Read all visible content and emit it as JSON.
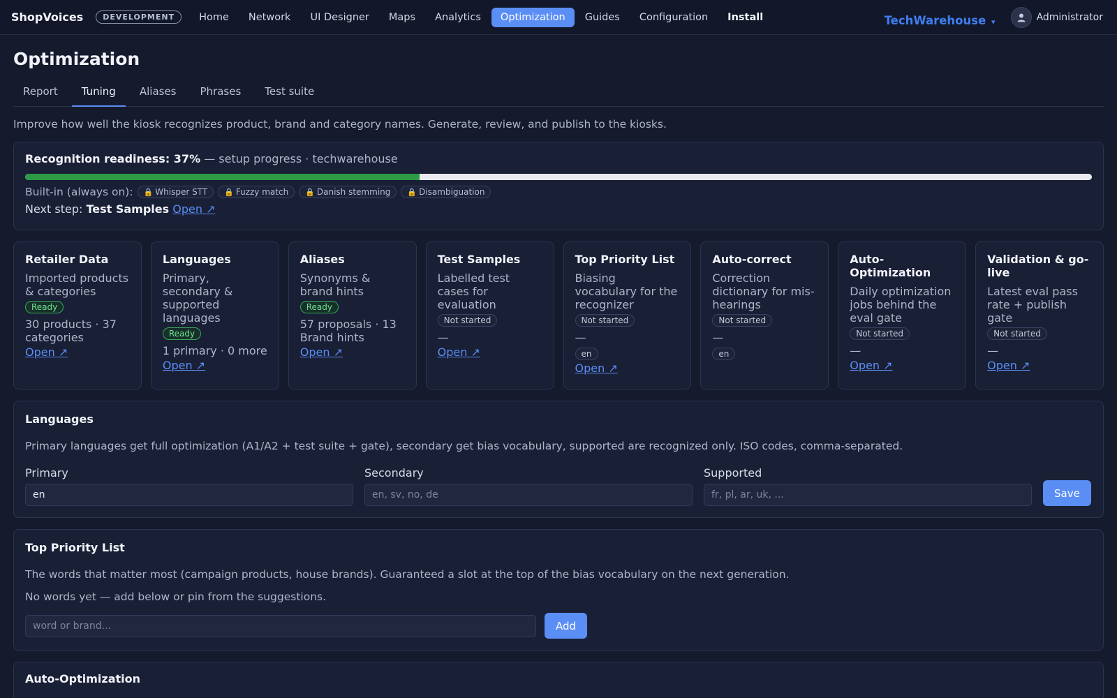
{
  "header": {
    "brand": "ShopVoices",
    "env_badge": "DEVELOPMENT",
    "nav": [
      "Home",
      "Network",
      "UI Designer",
      "Maps",
      "Analytics",
      "Optimization",
      "Guides",
      "Configuration",
      "Install"
    ],
    "active_nav": "Optimization",
    "tenant": "TechWarehouse",
    "tenant_caret": "▾",
    "user": "Administrator",
    "accent_color": "#5b8ef5"
  },
  "page": {
    "title": "Optimization",
    "tabs": [
      "Report",
      "Tuning",
      "Aliases",
      "Phrases",
      "Test suite"
    ],
    "active_tab": "Tuning",
    "intro": "Improve how well the kiosk recognizes product, brand and category names. Generate, review, and publish to the kiosks."
  },
  "readiness": {
    "title": "Recognition readiness: 37%",
    "suffix": "— setup progress · techwarehouse",
    "progress_percent": 37,
    "builtin_label": "Built-in (always on):",
    "builtin": [
      "Whisper STT",
      "Fuzzy match",
      "Danish stemming",
      "Disambiguation"
    ],
    "lock_icon": "🔒",
    "next_step_label": "Next step:",
    "next_step": "Test Samples",
    "open_label": "Open ↗"
  },
  "cards": [
    {
      "title": "Retailer Data",
      "desc": "Imported products & categories",
      "status": "Ready",
      "meta": "30 products · 37 categories",
      "open": "Open ↗"
    },
    {
      "title": "Languages",
      "desc": "Primary, secondary & supported languages",
      "status": "Ready",
      "meta": "1 primary · 0 more",
      "open": "Open ↗"
    },
    {
      "title": "Aliases",
      "desc": "Synonyms & brand hints",
      "status": "Ready",
      "meta": "57 proposals · 13 Brand hints",
      "open": "Open ↗"
    },
    {
      "title": "Test Samples",
      "desc": "Labelled test cases for evaluation",
      "status": "Not started",
      "meta": "—",
      "open": "Open ↗"
    },
    {
      "title": "Top Priority List",
      "desc": "Biasing vocabulary for the recognizer",
      "status": "Not started",
      "meta": "—",
      "tag": "en",
      "open": "Open ↗"
    },
    {
      "title": "Auto-correct",
      "desc": "Correction dictionary for mis-hearings",
      "status": "Not started",
      "meta": "—",
      "tag": "en"
    },
    {
      "title": "Auto-Optimization",
      "desc": "Daily optimization jobs behind the eval gate",
      "status": "Not started",
      "meta": "—",
      "open": "Open ↗"
    },
    {
      "title": "Validation & go-live",
      "desc": "Latest eval pass rate + publish gate",
      "status": "Not started",
      "meta": "—",
      "open": "Open ↗"
    }
  ],
  "languages": {
    "title": "Languages",
    "desc": "Primary languages get full optimization (A1/A2 + test suite + gate), secondary get bias vocabulary, supported are recognized only. ISO codes, comma-separated.",
    "primary_label": "Primary",
    "primary_value": "en",
    "secondary_label": "Secondary",
    "secondary_placeholder": "en, sv, no, de",
    "supported_label": "Supported",
    "supported_placeholder": "fr, pl, ar, uk, ...",
    "save_label": "Save"
  },
  "priority": {
    "title": "Top Priority List",
    "desc": "The words that matter most (campaign products, house brands). Guaranteed a slot at the top of the bias vocabulary on the next generation.",
    "empty": "No words yet — add below or pin from the suggestions.",
    "placeholder": "word or brand...",
    "add_label": "Add"
  },
  "auto_opt": {
    "title": "Auto-Optimization"
  }
}
